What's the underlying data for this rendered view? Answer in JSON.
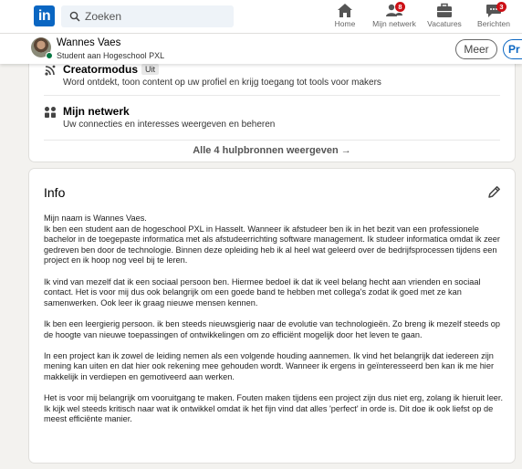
{
  "nav": {
    "search_placeholder": "Zoeken",
    "items": [
      {
        "label": "Home",
        "icon": "home-icon",
        "badge": ""
      },
      {
        "label": "Mijn netwerk",
        "icon": "network-icon",
        "badge": "8"
      },
      {
        "label": "Vacatures",
        "icon": "briefcase-icon",
        "badge": ""
      },
      {
        "label": "Berichten",
        "icon": "messaging-icon",
        "badge": "3"
      }
    ]
  },
  "profile": {
    "name": "Wannes Vaes",
    "headline": "Student aan Hogeschool PXL",
    "more_button": "Meer",
    "partial_button": "Pr"
  },
  "resources": {
    "items": [
      {
        "title": "Creatormodus",
        "tag": "Uit",
        "description": "Word ontdekt, toon content op uw profiel en krijg toegang tot tools voor makers",
        "icon": "creator-mode-icon"
      },
      {
        "title": "Mijn netwerk",
        "tag": "",
        "description": "Uw connecties en interesses weergeven en beheren",
        "icon": "people-icon"
      }
    ],
    "show_all": "Alle 4 hulpbronnen weergeven →"
  },
  "info": {
    "title": "Info",
    "paragraphs": [
      "Mijn naam is Wannes Vaes.\nIk ben een student aan de hogeschool PXL in Hasselt. Wanneer ik afstudeer ben ik in het bezit van een professionele bachelor in de toegepaste informatica met als afstudeerrichting software management. Ik studeer informatica omdat ik zeer gedreven ben door de technologie. Binnen deze opleiding heb ik al heel wat geleerd over de bedrijfsprocessen tijdens een project en ik hoop nog veel bij te leren.",
      "Ik vind van mezelf dat ik een sociaal persoon ben. Hiermee bedoel ik dat ik veel belang hecht aan vrienden en sociaal contact. Het is voor mij dus ook belangrijk om een goede band te hebben met collega's zodat ik goed met ze kan samenwerken. Ook leer ik graag nieuwe mensen kennen.",
      "Ik ben een leergierig persoon. ik ben steeds nieuwsgierig naar de evolutie van technologieën. Zo breng ik mezelf steeds op de hoogte van nieuwe toepassingen of ontwikkelingen om zo efficiënt mogelijk door het leven te gaan.",
      "In een project kan ik zowel de leiding nemen als een volgende houding aannemen. Ik vind het belangrijk dat iedereen zijn mening kan uiten en dat hier ook rekening mee gehouden wordt. Wanneer ik ergens in geïnteresseerd ben kan ik me hier makkelijk in verdiepen en gemotiveerd aan werken.",
      "Het is voor mij belangrijk om vooruitgang te maken. Fouten maken tijdens een project zijn dus niet erg, zolang ik hieruit leer. Ik kijk wel steeds kritisch naar wat ik ontwikkel omdat ik het fijn vind dat alles 'perfect' in orde is. Dit doe ik ook liefst op de meest efficiënte manier."
    ]
  },
  "colors": {
    "brand": "#0a66c2",
    "badge": "#cc1016",
    "online": "#057642",
    "background": "#f3f2ef"
  }
}
